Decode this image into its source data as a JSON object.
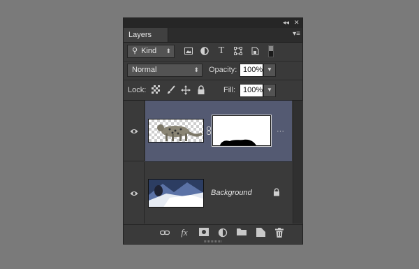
{
  "panel": {
    "tab_label": "Layers",
    "collapse_glyph": "◂◂",
    "close_glyph": "✕",
    "menu_glyph": "▾≡"
  },
  "filter": {
    "search_glyph": "⚲",
    "kind_label": "Kind",
    "icons": [
      "image-filter-icon",
      "adjustment-filter-icon",
      "type-filter-icon",
      "shape-filter-icon",
      "smart-object-filter-icon",
      "filter-toggle-switch"
    ]
  },
  "blend": {
    "mode": "Normal",
    "opacity_label": "Opacity:",
    "opacity_value": "100%"
  },
  "lock": {
    "label": "Lock:",
    "fill_label": "Fill:",
    "fill_value": "100%"
  },
  "layers": [
    {
      "name": "",
      "has_mask": true,
      "selected": true,
      "visible": true,
      "effects_glyph": "···"
    },
    {
      "name": "Background",
      "locked": true,
      "selected": false,
      "visible": true
    }
  ],
  "bottom_tools": [
    "link-layers-icon",
    "fx-icon",
    "add-mask-icon",
    "adjustment-layer-icon",
    "group-folder-icon",
    "new-layer-icon",
    "trash-icon"
  ],
  "fx_label": "fx",
  "colors": {
    "selected_layer": "#545a72",
    "panel_bg": "#3a3a3a",
    "app_bg": "#7a7a7a"
  }
}
